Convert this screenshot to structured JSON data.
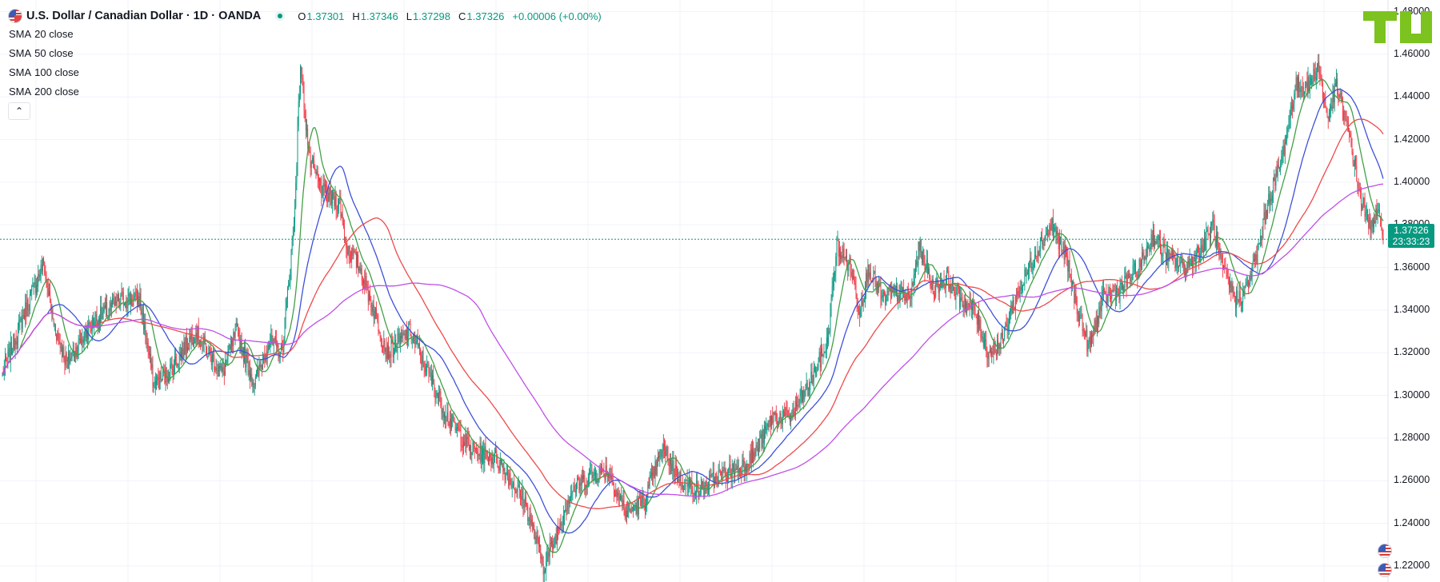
{
  "header": {
    "title": "U.S. Dollar / Canadian Dollar · 1D · OANDA",
    "open_key": "O",
    "open": "1.37301",
    "high_key": "H",
    "high": "1.37346",
    "low_key": "L",
    "low": "1.37298",
    "close_key": "C",
    "close": "1.37326",
    "change": "+0.00006 (+0.00%)"
  },
  "indicators": [
    {
      "label": "SMA",
      "params": "20 close",
      "color": "#43a047"
    },
    {
      "label": "SMA",
      "params": "50 close",
      "color": "#3f51d8"
    },
    {
      "label": "SMA",
      "params": "100 close",
      "color": "#ef4a4a"
    },
    {
      "label": "SMA",
      "params": "200 close",
      "color": "#c04fe8"
    }
  ],
  "collapse_icon": "chevron-up-icon",
  "price_tag": {
    "price": "1.37326",
    "countdown": "23:33:23",
    "color": "#089981"
  },
  "colors": {
    "up": "#089981",
    "down": "#f23645",
    "grid": "#f0f3fa",
    "last_price_line": "#089981",
    "logo": "#7cc31f"
  },
  "chart_data": {
    "type": "candlestick",
    "symbol": "USD/CAD",
    "interval": "1D",
    "ylim": [
      1.214,
      1.4832
    ],
    "y_ticks": [
      "1.48000",
      "1.46000",
      "1.44000",
      "1.42000",
      "1.40000",
      "1.38000",
      "1.36000",
      "1.34000",
      "1.32000",
      "1.30000",
      "1.28000",
      "1.26000",
      "1.24000",
      "1.22000"
    ],
    "last_price": 1.37326,
    "close_path": [
      [
        0,
        1.31
      ],
      [
        25,
        1.34
      ],
      [
        45,
        1.362
      ],
      [
        55,
        1.335
      ],
      [
        70,
        1.315
      ],
      [
        100,
        1.335
      ],
      [
        130,
        1.345
      ],
      [
        150,
        1.345
      ],
      [
        165,
        1.305
      ],
      [
        180,
        1.31
      ],
      [
        210,
        1.33
      ],
      [
        240,
        1.31
      ],
      [
        255,
        1.33
      ],
      [
        275,
        1.305
      ],
      [
        290,
        1.325
      ],
      [
        305,
        1.32
      ],
      [
        318,
        1.38
      ],
      [
        325,
        1.455
      ],
      [
        335,
        1.41
      ],
      [
        350,
        1.395
      ],
      [
        368,
        1.39
      ],
      [
        375,
        1.37
      ],
      [
        390,
        1.36
      ],
      [
        420,
        1.32
      ],
      [
        445,
        1.33
      ],
      [
        465,
        1.31
      ],
      [
        485,
        1.29
      ],
      [
        510,
        1.275
      ],
      [
        540,
        1.27
      ],
      [
        570,
        1.25
      ],
      [
        590,
        1.22
      ],
      [
        600,
        1.23
      ],
      [
        620,
        1.255
      ],
      [
        640,
        1.262
      ],
      [
        660,
        1.265
      ],
      [
        680,
        1.245
      ],
      [
        700,
        1.25
      ],
      [
        720,
        1.275
      ],
      [
        740,
        1.26
      ],
      [
        760,
        1.255
      ],
      [
        780,
        1.262
      ],
      [
        800,
        1.265
      ],
      [
        820,
        1.272
      ],
      [
        840,
        1.29
      ],
      [
        860,
        1.29
      ],
      [
        880,
        1.305
      ],
      [
        900,
        1.325
      ],
      [
        910,
        1.37
      ],
      [
        925,
        1.36
      ],
      [
        935,
        1.34
      ],
      [
        945,
        1.36
      ],
      [
        960,
        1.345
      ],
      [
        975,
        1.348
      ],
      [
        990,
        1.345
      ],
      [
        1000,
        1.37
      ],
      [
        1015,
        1.35
      ],
      [
        1030,
        1.355
      ],
      [
        1045,
        1.345
      ],
      [
        1060,
        1.34
      ],
      [
        1075,
        1.32
      ],
      [
        1090,
        1.325
      ],
      [
        1100,
        1.34
      ],
      [
        1115,
        1.355
      ],
      [
        1130,
        1.37
      ],
      [
        1145,
        1.38
      ],
      [
        1160,
        1.365
      ],
      [
        1170,
        1.345
      ],
      [
        1185,
        1.322
      ],
      [
        1200,
        1.345
      ],
      [
        1220,
        1.35
      ],
      [
        1240,
        1.36
      ],
      [
        1255,
        1.375
      ],
      [
        1270,
        1.365
      ],
      [
        1290,
        1.36
      ],
      [
        1310,
        1.37
      ],
      [
        1320,
        1.38
      ],
      [
        1330,
        1.36
      ],
      [
        1345,
        1.345
      ],
      [
        1355,
        1.348
      ],
      [
        1368,
        1.365
      ],
      [
        1380,
        1.39
      ],
      [
        1395,
        1.41
      ],
      [
        1410,
        1.445
      ],
      [
        1425,
        1.445
      ],
      [
        1435,
        1.455
      ],
      [
        1445,
        1.43
      ],
      [
        1455,
        1.445
      ],
      [
        1470,
        1.42
      ],
      [
        1480,
        1.395
      ],
      [
        1490,
        1.38
      ],
      [
        1500,
        1.385
      ],
      [
        1506,
        1.373
      ]
    ],
    "series": [
      {
        "name": "SMA 20 close",
        "period": 20
      },
      {
        "name": "SMA 50 close",
        "period": 50
      },
      {
        "name": "SMA 100 close",
        "period": 100
      },
      {
        "name": "SMA 200 close",
        "period": 200
      }
    ]
  }
}
